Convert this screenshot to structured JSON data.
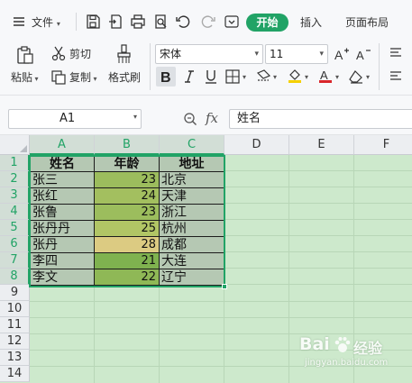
{
  "menu": {
    "file_label": "文件",
    "tabs": [
      {
        "label": "开始",
        "active": true
      },
      {
        "label": "插入",
        "active": false
      },
      {
        "label": "页面布局",
        "active": false
      }
    ]
  },
  "ribbon": {
    "paste_label": "粘贴",
    "cut_label": "剪切",
    "copy_label": "复制",
    "format_painter_label": "格式刷",
    "font_name": "宋体",
    "font_size": "11",
    "accent_color": "#21a366",
    "font_color_bar": "#d9262b",
    "fill_color_bar": "#f5d000"
  },
  "formula_bar": {
    "name_box": "A1",
    "fx_label": "fx",
    "content": "姓名"
  },
  "sheet": {
    "columns": [
      "A",
      "B",
      "C",
      "D",
      "E",
      "F"
    ],
    "row_numbers": [
      "1",
      "2",
      "3",
      "4",
      "5",
      "6",
      "7",
      "8",
      "9",
      "10",
      "11",
      "12",
      "13",
      "14"
    ],
    "header": [
      "姓名",
      "年龄",
      "地址"
    ],
    "rows": [
      {
        "name": "张三",
        "age": "23",
        "addr": "北京",
        "age_fill": "#9cbd5d"
      },
      {
        "name": "张红",
        "age": "24",
        "addr": "天津",
        "age_fill": "#a3bf5f"
      },
      {
        "name": "张鲁",
        "age": "23",
        "addr": "浙江",
        "age_fill": "#9cbd5d"
      },
      {
        "name": "张丹丹",
        "age": "25",
        "addr": "杭州",
        "age_fill": "#b1c565"
      },
      {
        "name": "张丹",
        "age": "28",
        "addr": "成都",
        "age_fill": "#dccb82"
      },
      {
        "name": "李四",
        "age": "21",
        "addr": "大连",
        "age_fill": "#7fb24f"
      },
      {
        "name": "李文",
        "age": "22",
        "addr": "辽宁",
        "age_fill": "#8fb856"
      }
    ],
    "grid_bg": "#cde9cc",
    "table_cell_bg": "#b5c8b3"
  },
  "watermark": {
    "brand_text": "Bai",
    "brand_text_2": "经验",
    "domain": "jingyan.baidu.com"
  }
}
